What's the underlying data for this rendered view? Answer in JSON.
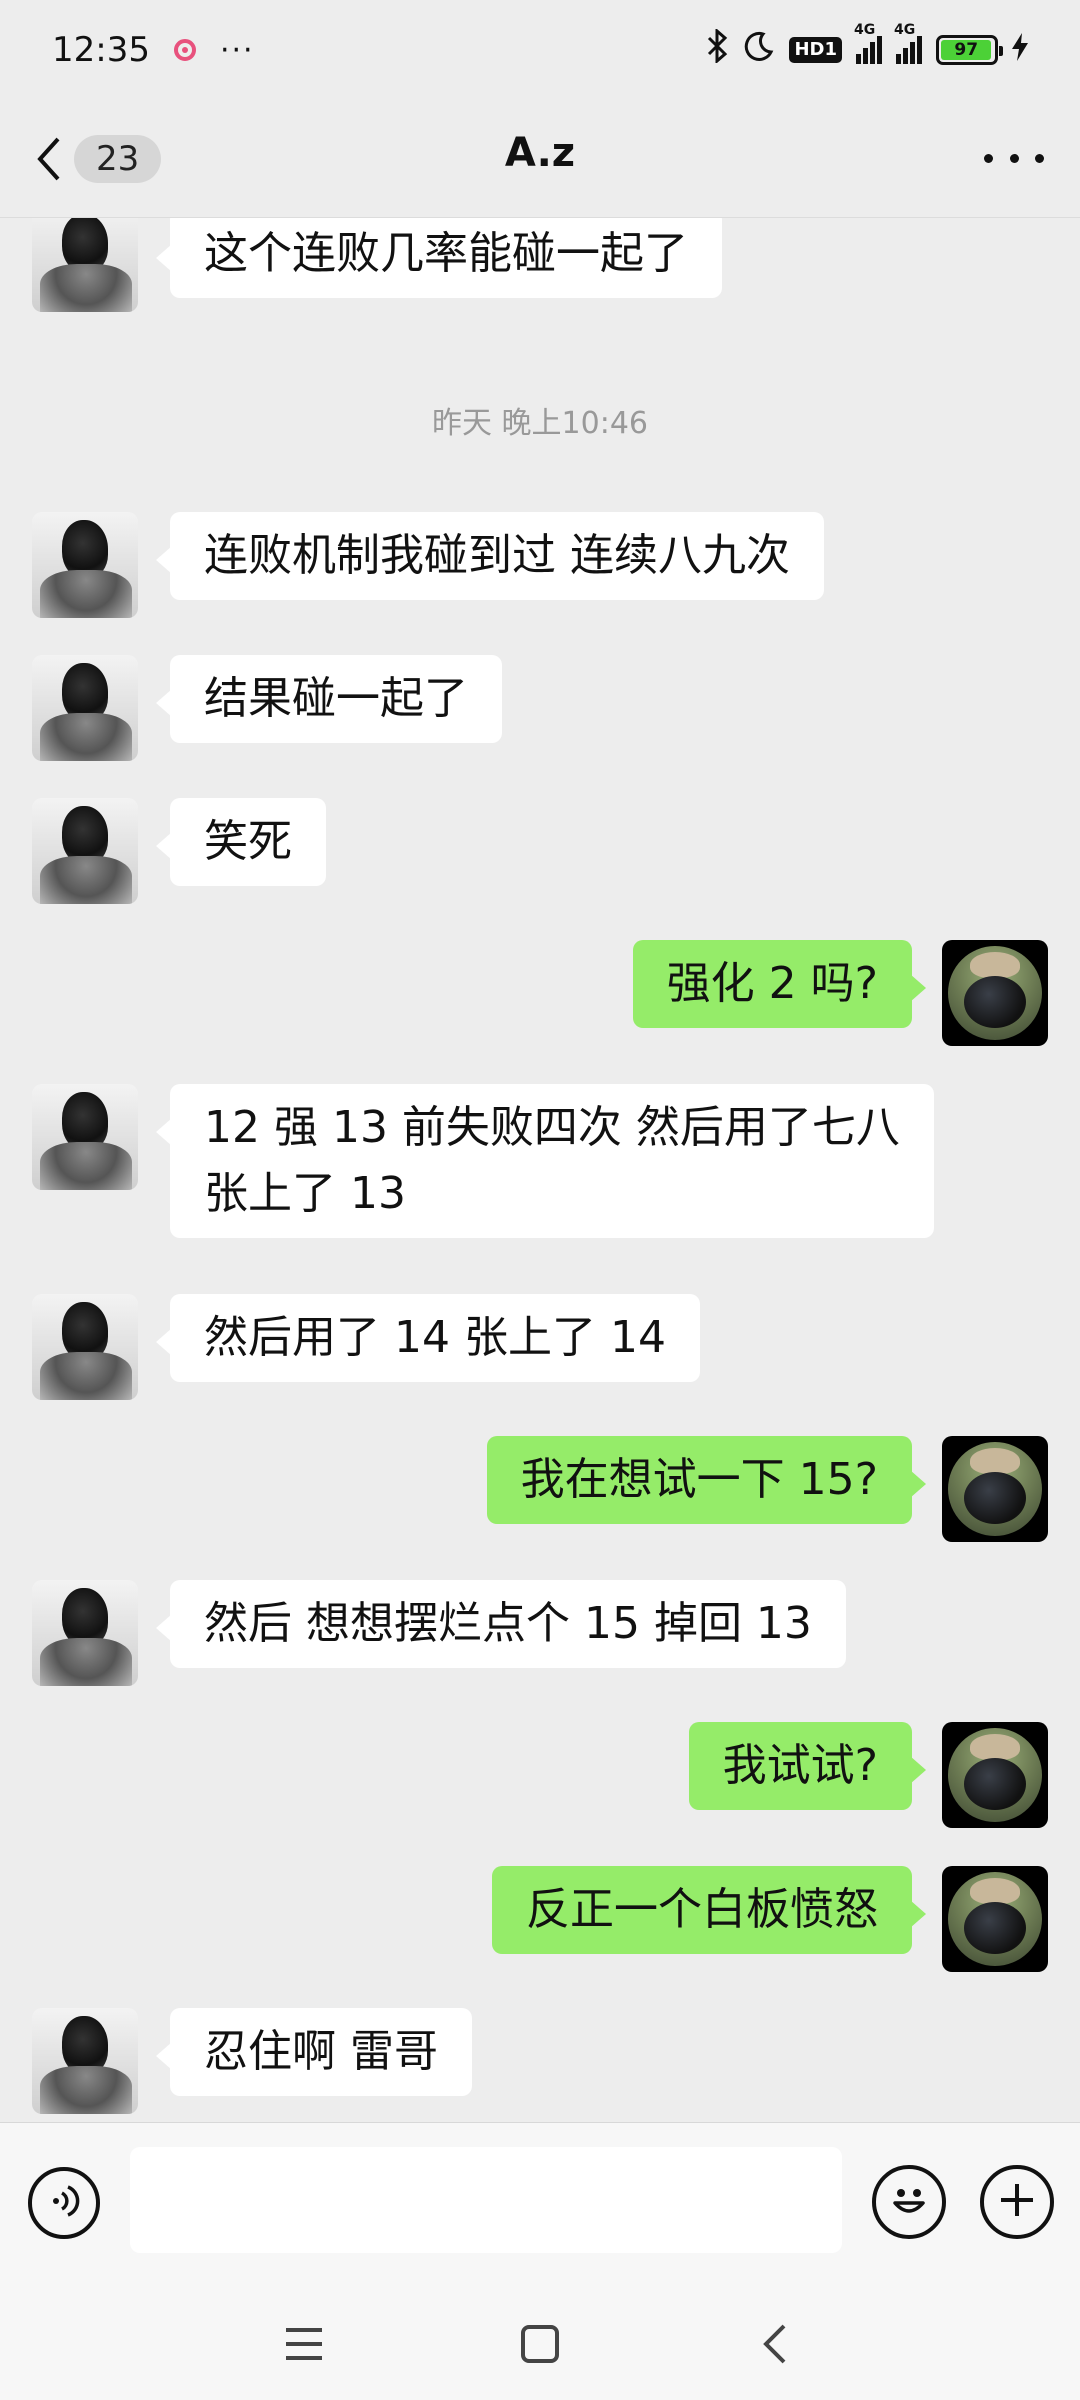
{
  "status_bar": {
    "time": "12:35",
    "more_dots": "···",
    "hd_label": "HD1",
    "network_1": "4G",
    "network_2": "4G",
    "battery_percent": "97",
    "battery_level": 0.97,
    "charging_icon": "lightning-icon"
  },
  "header": {
    "unread_count": "23",
    "title": "A.z"
  },
  "chat": {
    "timestamp": "昨天 晚上10:46",
    "messages": [
      {
        "sender": "them",
        "text": "这个连败几率能碰一起了"
      },
      {
        "sender": "them",
        "text": "连败机制我碰到过 连续八九次"
      },
      {
        "sender": "them",
        "text": "结果碰一起了"
      },
      {
        "sender": "them",
        "text": "笑死"
      },
      {
        "sender": "me",
        "text": "强化 2 吗?"
      },
      {
        "sender": "them",
        "line1": "12 强 13 前失败四次 然后用了七八",
        "line2": "张上了 13"
      },
      {
        "sender": "them",
        "text": "然后用了 14 张上了 14"
      },
      {
        "sender": "me",
        "text": "我在想试一下 15?"
      },
      {
        "sender": "them",
        "text": "然后 想想摆烂点个 15 掉回 13"
      },
      {
        "sender": "me",
        "text": "我试试?"
      },
      {
        "sender": "me",
        "text": "反正一个白板愤怒"
      },
      {
        "sender": "them",
        "text": "忍住啊 雷哥"
      }
    ]
  },
  "input": {
    "voice_icon": "voice-icon",
    "emoji_icon": "emoji-icon",
    "plus_icon": "plus-icon"
  },
  "system_nav": {
    "menu_icon": "menu-icon",
    "home_icon": "home-icon",
    "back_icon": "back-icon"
  }
}
